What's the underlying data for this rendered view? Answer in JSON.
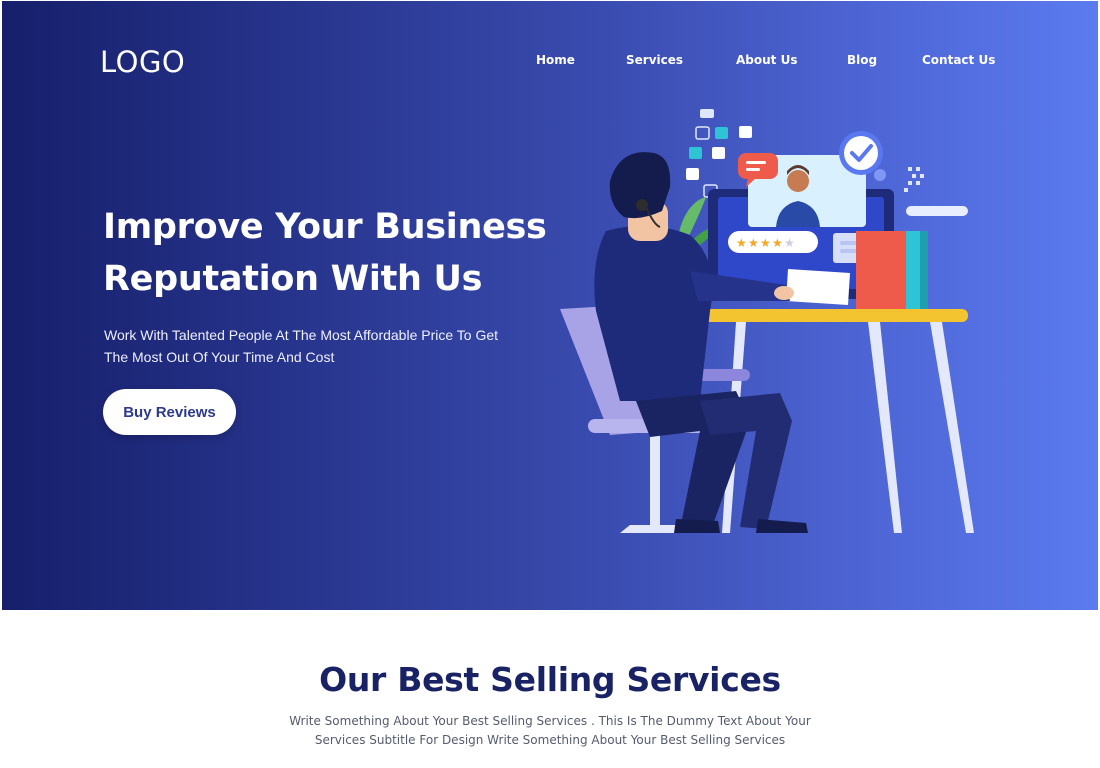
{
  "header": {
    "logo": "LOGO",
    "nav": [
      {
        "label": "Home"
      },
      {
        "label": "Services"
      },
      {
        "label": "About Us"
      },
      {
        "label": "Blog"
      },
      {
        "label": "Contact Us"
      }
    ]
  },
  "hero": {
    "headline_line1": "Improve Your Business",
    "headline_line2": "Reputation With Us",
    "subtext_line1": "Work With Talented People At The Most Affordable Price To Get",
    "subtext_line2": "The Most Out Of Your Time And Cost",
    "cta_label": "Buy Reviews",
    "rating_stars": 4,
    "rating_max": 5
  },
  "services": {
    "title": "Our Best Selling Services",
    "subtitle_line1": "Write Something About Your Best Selling Services . This Is The Dummy Text About Your",
    "subtitle_line2": "Services Subtitle For Design Write Something About Your Best Selling Services"
  },
  "colors": {
    "hero_gradient_start": "#161f6b",
    "hero_gradient_end": "#5b7bef",
    "title_navy": "#1a2266",
    "button_text": "#2d3a8c",
    "desk_top": "#f4c430",
    "chair": "#a7a3e6",
    "star": "#f5a623",
    "check_badge": "#5a78f0",
    "chat_bubble": "#ef5b4a"
  }
}
